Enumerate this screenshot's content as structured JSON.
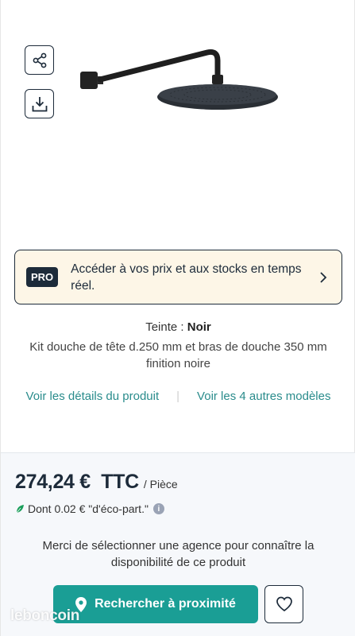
{
  "icons": {
    "share": "share-icon",
    "download": "download-icon",
    "chevron": "chevron-right-icon",
    "leaf": "leaf-icon",
    "info": "info-icon",
    "pin": "location-pin-icon",
    "heart": "heart-icon"
  },
  "pro_banner": {
    "badge": "PRO",
    "text": "Accéder à vos prix et aux stocks en temps réel."
  },
  "product": {
    "teinte_label": "Teinte :",
    "teinte_value": "Noir",
    "description": "Kit douche de tête d.250 mm et bras de douche 350 mm finition noire"
  },
  "links": {
    "details": "Voir les détails du produit",
    "separator": "|",
    "models": "Voir les 4 autres modèles"
  },
  "pricing": {
    "price": "274,24 €  TTC",
    "unit": "/ Pièce",
    "eco": "Dont 0.02 € \"d'éco-part.\"",
    "info_glyph": "i"
  },
  "agency": {
    "message": "Merci de sélectionner une agence pour connaître la disponibilité de ce produit",
    "search_button": "Rechercher à proximité"
  },
  "watermark": "leboncoin",
  "colors": {
    "navy": "#1d2b3a",
    "teal": "#1a9e95",
    "link": "#2a8c8c",
    "banner_bg": "#fdf6e7",
    "leaf": "#1a9e5a"
  }
}
